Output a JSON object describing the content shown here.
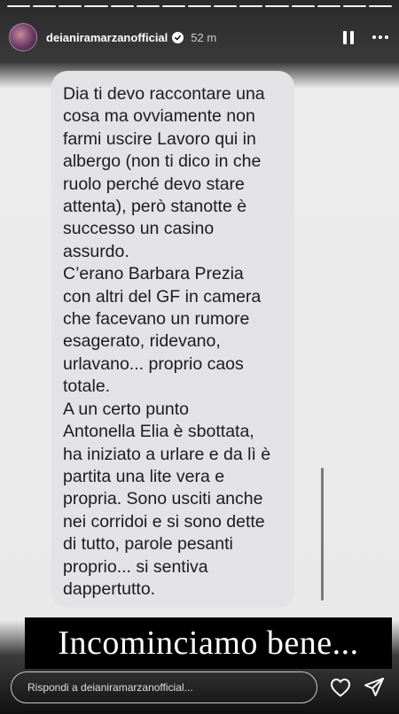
{
  "header": {
    "username": "deianiramarzanofficial",
    "time": "52 m",
    "progress_segments": 15
  },
  "message": {
    "text": "Dia ti devo raccontare una\ncosa ma ovviamente  non\nfarmi uscire Lavoro qui in\nalbergo (non ti dico in che\nruolo perché devo stare\nattenta), però stanotte è\nsuccesso un casino\nassurdo.\nC’erano Barbara Prezia\ncon altri del GF in camera\nche facevano un rumore\nesagerato, ridevano,\nurlavano... proprio caos\ntotale.\nA un certo punto\nAntonella Elia è sbottata,\nha iniziato a urlare e da lì è\npartita una lite vera e\npropria. Sono usciti anche\nnei corridoi e si sono dette\ndi tutto, parole pesanti\nproprio... si sentiva\ndappertutto."
  },
  "caption": {
    "text": "Incominciamo bene..."
  },
  "footer": {
    "reply_placeholder": "Rispondi a deianiramarzanofficial..."
  },
  "icons": {
    "pause": "pause-icon",
    "more": "more-icon",
    "like": "heart-icon",
    "share": "send-icon",
    "verified": "verified-badge-icon"
  }
}
